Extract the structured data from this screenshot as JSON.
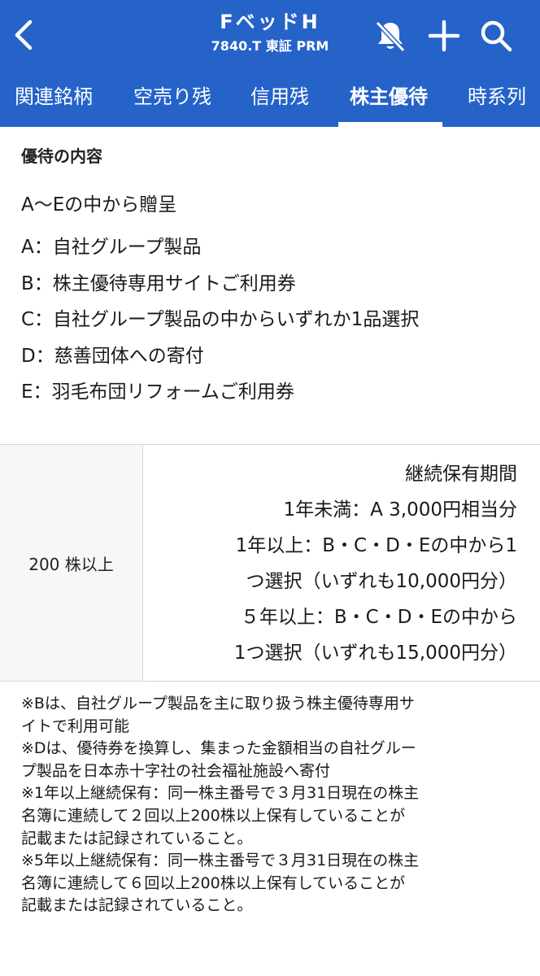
{
  "header": {
    "title": "FベッドH",
    "subtitle": "7840.T 東証 PRM",
    "background_color": "#2563c9",
    "icons": [
      "back-arrow-icon",
      "bell-muted-icon",
      "plus-icon",
      "search-icon"
    ]
  },
  "tabs": [
    {
      "label": "関連銘柄",
      "active": false
    },
    {
      "label": "空売り残",
      "active": false
    },
    {
      "label": "信用残",
      "active": false
    },
    {
      "label": "株主優待",
      "active": true
    },
    {
      "label": "時系列",
      "active": false
    }
  ],
  "benefit": {
    "section_title": "優待の内容",
    "lead": "A～Eの中から贈呈",
    "options": [
      "A：自社グループ製品",
      "B：株主優待専用サイトご利用券",
      "C：自社グループ製品の中からいずれか1品選択",
      "D：慈善団体への寄付",
      "E：羽毛布団リフォームご利用券"
    ]
  },
  "table": {
    "shares": "200 株以上",
    "details": [
      "継続保有期間",
      "1年未満：A 3,000円相当分",
      "1年以上：B・C・D・Eの中から1",
      "つ選択（いずれも10,000円分）",
      "５年以上：B・C・D・Eの中から",
      "1つ選択（いずれも15,000円分）"
    ]
  },
  "notes": [
    "※Bは、自社グループ製品を主に取り扱う株主優待専用サ",
    "イトで利用可能",
    "※Dは、優待券を換算し、集まった金額相当の自社グルー",
    "プ製品を日本赤十字社の社会福祉施設へ寄付",
    "※1年以上継続保有：同一株主番号で３月31日現在の株主",
    "名簿に連続して２回以上200株以上保有していることが",
    "記載または記録されていること。",
    "※5年以上継続保有：同一株主番号で３月31日現在の株主",
    "名簿に連続して６回以上200株以上保有していることが",
    "記載または記録されていること。"
  ]
}
